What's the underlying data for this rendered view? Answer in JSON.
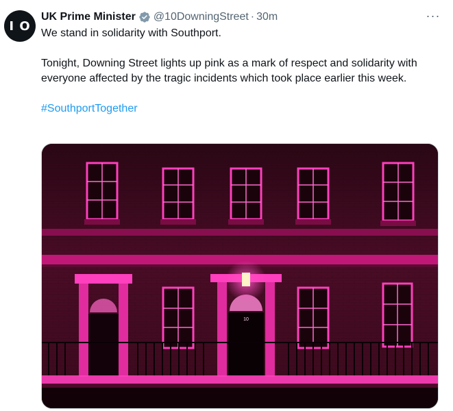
{
  "author": {
    "avatar_text": "I O",
    "display_name": "UK Prime Minister",
    "verified_icon": "verified-badge-icon",
    "handle": "@10DowningStreet",
    "separator": "·",
    "time": "30m"
  },
  "more_label": "···",
  "tweet": {
    "line1": "We stand in solidarity with Southport.",
    "line2": "Tonight, Downing Street lights up pink as a mark of respect and solidarity with everyone affected by the tragic incidents which took place earlier this week.",
    "hashtag": "#SouthportTogether"
  },
  "media": {
    "image_name": "downing-street-pink-photo",
    "door_number": "10"
  },
  "colors": {
    "accent": "#1d9bf0",
    "pink": "#ff2fb4",
    "brick": "#3a0a1c"
  }
}
